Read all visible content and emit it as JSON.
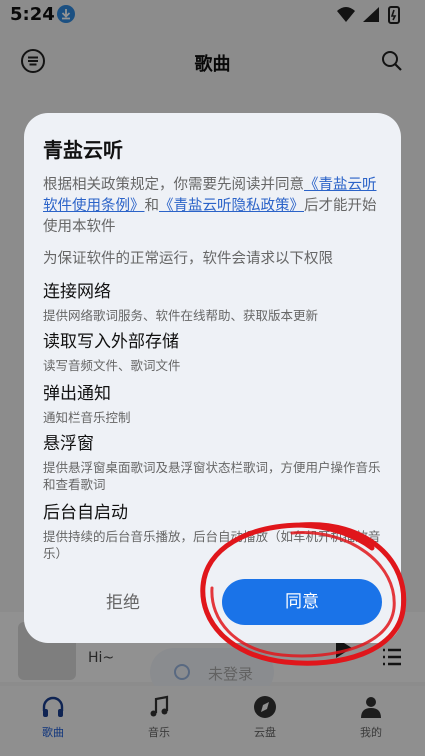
{
  "status": {
    "time": "5:24"
  },
  "appbar": {
    "title": "歌曲"
  },
  "player": {
    "subtitle": "Hi~"
  },
  "toast": {
    "text": "未登录"
  },
  "tabs": [
    {
      "label": "歌曲",
      "icon": "headphones-icon"
    },
    {
      "label": "音乐",
      "icon": "music-note-icon"
    },
    {
      "label": "云盘",
      "icon": "compass-icon"
    },
    {
      "label": "我的",
      "icon": "person-icon"
    }
  ],
  "dialog": {
    "title": "青盐云听",
    "intro_prefix": "根据相关政策规定，你需要先阅读并同意",
    "link_terms": "《青盐云听软件使用条例》",
    "intro_and": "和",
    "link_privacy": "《青盐云听隐私政策》",
    "intro_suffix": "后才能开始使用本软件",
    "permissions_intro": "为保证软件的正常运行，软件会请求以下权限",
    "permissions": [
      {
        "title": "连接网络",
        "desc": "提供网络歌词服务、软件在线帮助、获取版本更新"
      },
      {
        "title": "读取写入外部存储",
        "desc": "读写音频文件、歌词文件"
      },
      {
        "title": "弹出通知",
        "desc": "通知栏音乐控制"
      },
      {
        "title": "悬浮窗",
        "desc": "提供悬浮窗桌面歌词及悬浮窗状态栏歌词，方便用户操作音乐和查看歌词"
      },
      {
        "title": "后台自启动",
        "desc": "提供持续的后台音乐播放，后台自动播放（如车机开机播放音乐）"
      }
    ],
    "reject_label": "拒绝",
    "agree_label": "同意"
  },
  "colors": {
    "accent": "#1a73e8",
    "annotation": "#e0161b"
  }
}
